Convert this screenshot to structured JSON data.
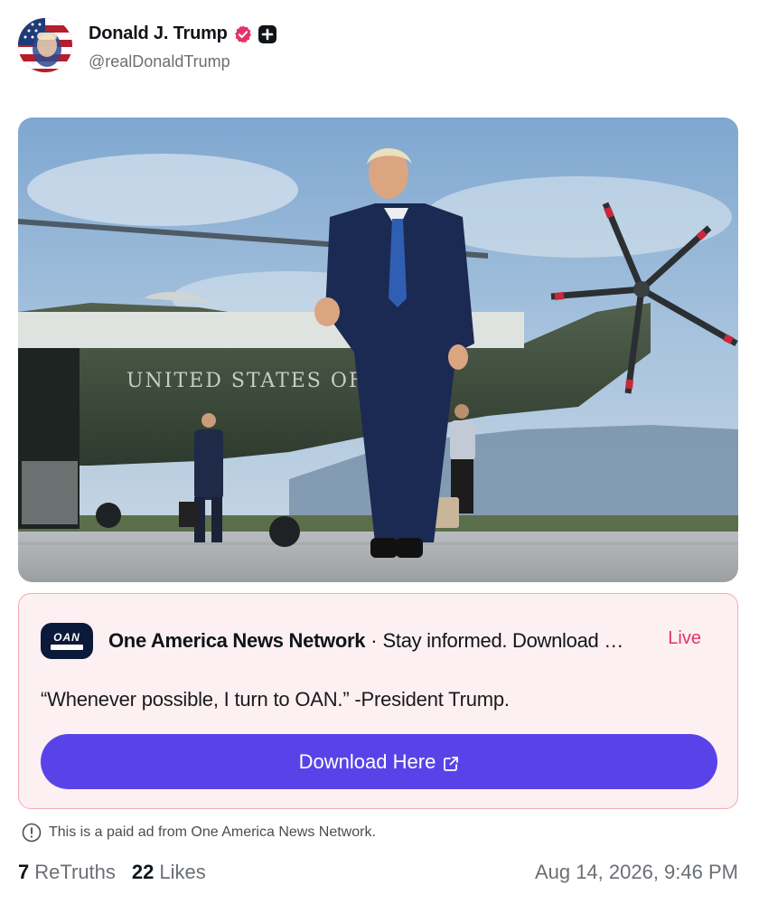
{
  "post": {
    "author": {
      "display_name": "Donald J. Trump",
      "handle": "@realDonaldTrump",
      "avatar_icon": "flag-portrait-avatar",
      "verified_badge_color": "#e5336a"
    },
    "photo": {
      "helicopter_text": "UNITED STATES OF"
    }
  },
  "ad": {
    "sponsor_logo_text": "OAN",
    "sponsor_name": "One America News Network",
    "separator": "·",
    "tagline": "Stay informed. Download the app",
    "live_label": "Live",
    "quote": "“Whenever possible, I turn to OAN.” -President Trump.",
    "button_label": "Download Here",
    "button_icon": "external-link-icon",
    "colors": {
      "card_bg": "#fdf0f2",
      "card_border": "#f3a9ba",
      "button_bg": "#5943e8",
      "live": "#e53368"
    }
  },
  "disclaimer": {
    "icon": "info-circle-icon",
    "text": "This is a paid ad from One America News Network."
  },
  "footer": {
    "retruths_count": "7",
    "retruths_label": "ReTruths",
    "likes_count": "22",
    "likes_label": "Likes",
    "timestamp": "Aug 14, 2026, 9:46 PM"
  }
}
